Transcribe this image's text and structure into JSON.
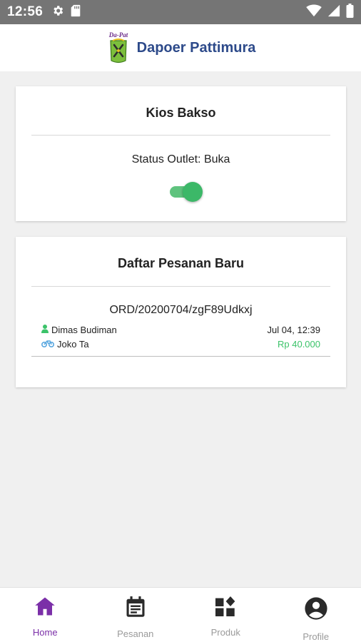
{
  "status_bar": {
    "time": "12:56",
    "left_icons": [
      "settings-icon",
      "sd-card-icon"
    ],
    "right_icons": [
      "wifi-icon",
      "signal-icon",
      "battery-icon"
    ]
  },
  "header": {
    "logo_text": "Da-Pat",
    "title": "Dapoer Pattimura"
  },
  "outlet_card": {
    "name": "Kios Bakso",
    "status_text": "Status Outlet: Buka",
    "toggle_on": true,
    "accent_color": "#3cb868"
  },
  "orders_card": {
    "title": "Daftar Pesanan Baru",
    "orders": [
      {
        "id": "ORD/20200704/zgF89Udkxj",
        "customer": "Dimas Budiman",
        "driver": "Joko Ta",
        "datetime": "Jul 04, 12:39",
        "price": "Rp 40.000",
        "price_color": "#3cc36a"
      }
    ]
  },
  "bottom_nav": {
    "active_color": "#7b2fa8",
    "items": [
      {
        "label": "Home",
        "icon": "home-icon",
        "active": true
      },
      {
        "label": "Pesanan",
        "icon": "calendar-icon",
        "active": false
      },
      {
        "label": "Produk",
        "icon": "widgets-icon",
        "active": false
      },
      {
        "label": "Profile",
        "icon": "account-circle-icon",
        "active": false
      }
    ]
  }
}
